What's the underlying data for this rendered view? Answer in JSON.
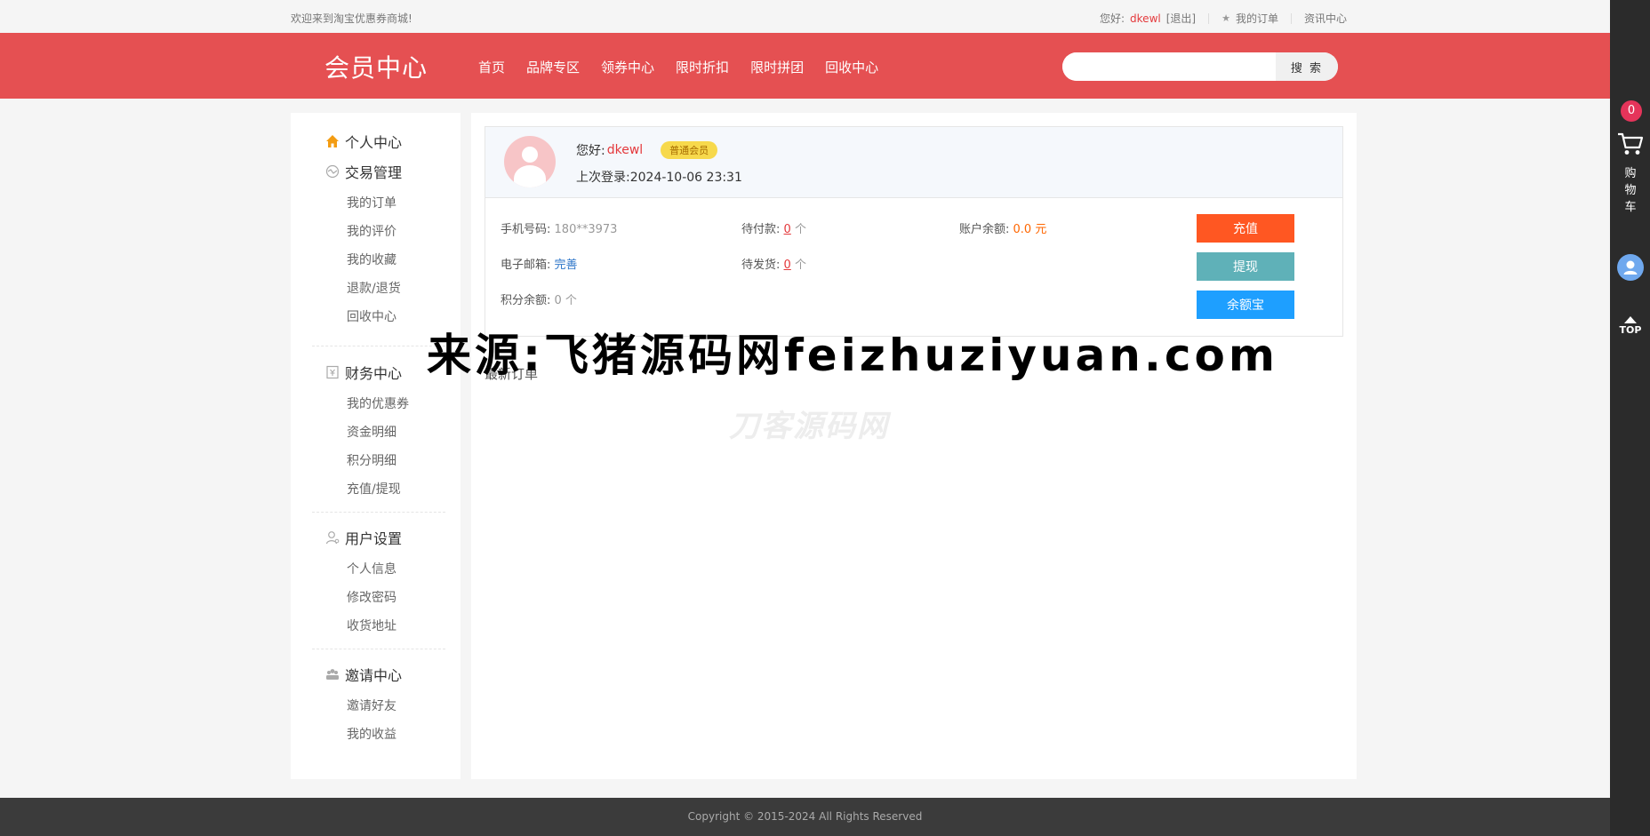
{
  "topbar": {
    "welcome": "欢迎来到淘宝优惠券商城!",
    "hello": "您好:",
    "username": "dkewl",
    "logout": "[退出]",
    "my_orders": "我的订单",
    "news": "资讯中心"
  },
  "header": {
    "logo": "会员中心",
    "nav": [
      "首页",
      "品牌专区",
      "领券中心",
      "限时折扣",
      "限时拼团",
      "回收中心"
    ],
    "search_placeholder": "",
    "search_button": "搜 索"
  },
  "sidebar": {
    "personal_center": "个人中心",
    "trade": {
      "title": "交易管理",
      "items": [
        "我的订单",
        "我的评价",
        "我的收藏",
        "退款/退货",
        "回收中心"
      ]
    },
    "finance": {
      "title": "财务中心",
      "items": [
        "我的优惠券",
        "资金明细",
        "积分明细",
        "充值/提现"
      ]
    },
    "settings": {
      "title": "用户设置",
      "items": [
        "个人信息",
        "修改密码",
        "收货地址"
      ]
    },
    "invite": {
      "title": "邀请中心",
      "items": [
        "邀请好友",
        "我的收益"
      ]
    }
  },
  "profile": {
    "hello": "您好:",
    "username": "dkewl",
    "level": "普通会员",
    "last_login_label": "上次登录:",
    "last_login": "2024-10-06 23:31"
  },
  "account": {
    "phone_label": "手机号码:",
    "phone": "180**3973",
    "email_label": "电子邮箱:",
    "email": "完善",
    "points_label": "积分余额:",
    "points": "0 个",
    "pending_pay_label": "待付款:",
    "pending_pay": "0",
    "pending_ship_label": "待发货:",
    "pending_ship": "0",
    "unit": "个",
    "balance_label": "账户余额:",
    "balance": "0.0 元"
  },
  "buttons": {
    "recharge": "充值",
    "withdraw": "提现",
    "yeb": "余额宝"
  },
  "latest_orders": "最新订单",
  "watermark_faint": "刀客源码网",
  "overlay_watermark": "来源:飞猪源码网feizhuziyuan.com",
  "footer": "Copyright © 2015-2024 All Rights Reserved",
  "rbar": {
    "cart_count": "0",
    "cart_label": "购物车",
    "top": "TOP"
  },
  "colors": {
    "brand": "#e55052",
    "recharge": "#ff5722",
    "withdraw": "#5fb1b8",
    "yeb": "#1e9fff"
  }
}
